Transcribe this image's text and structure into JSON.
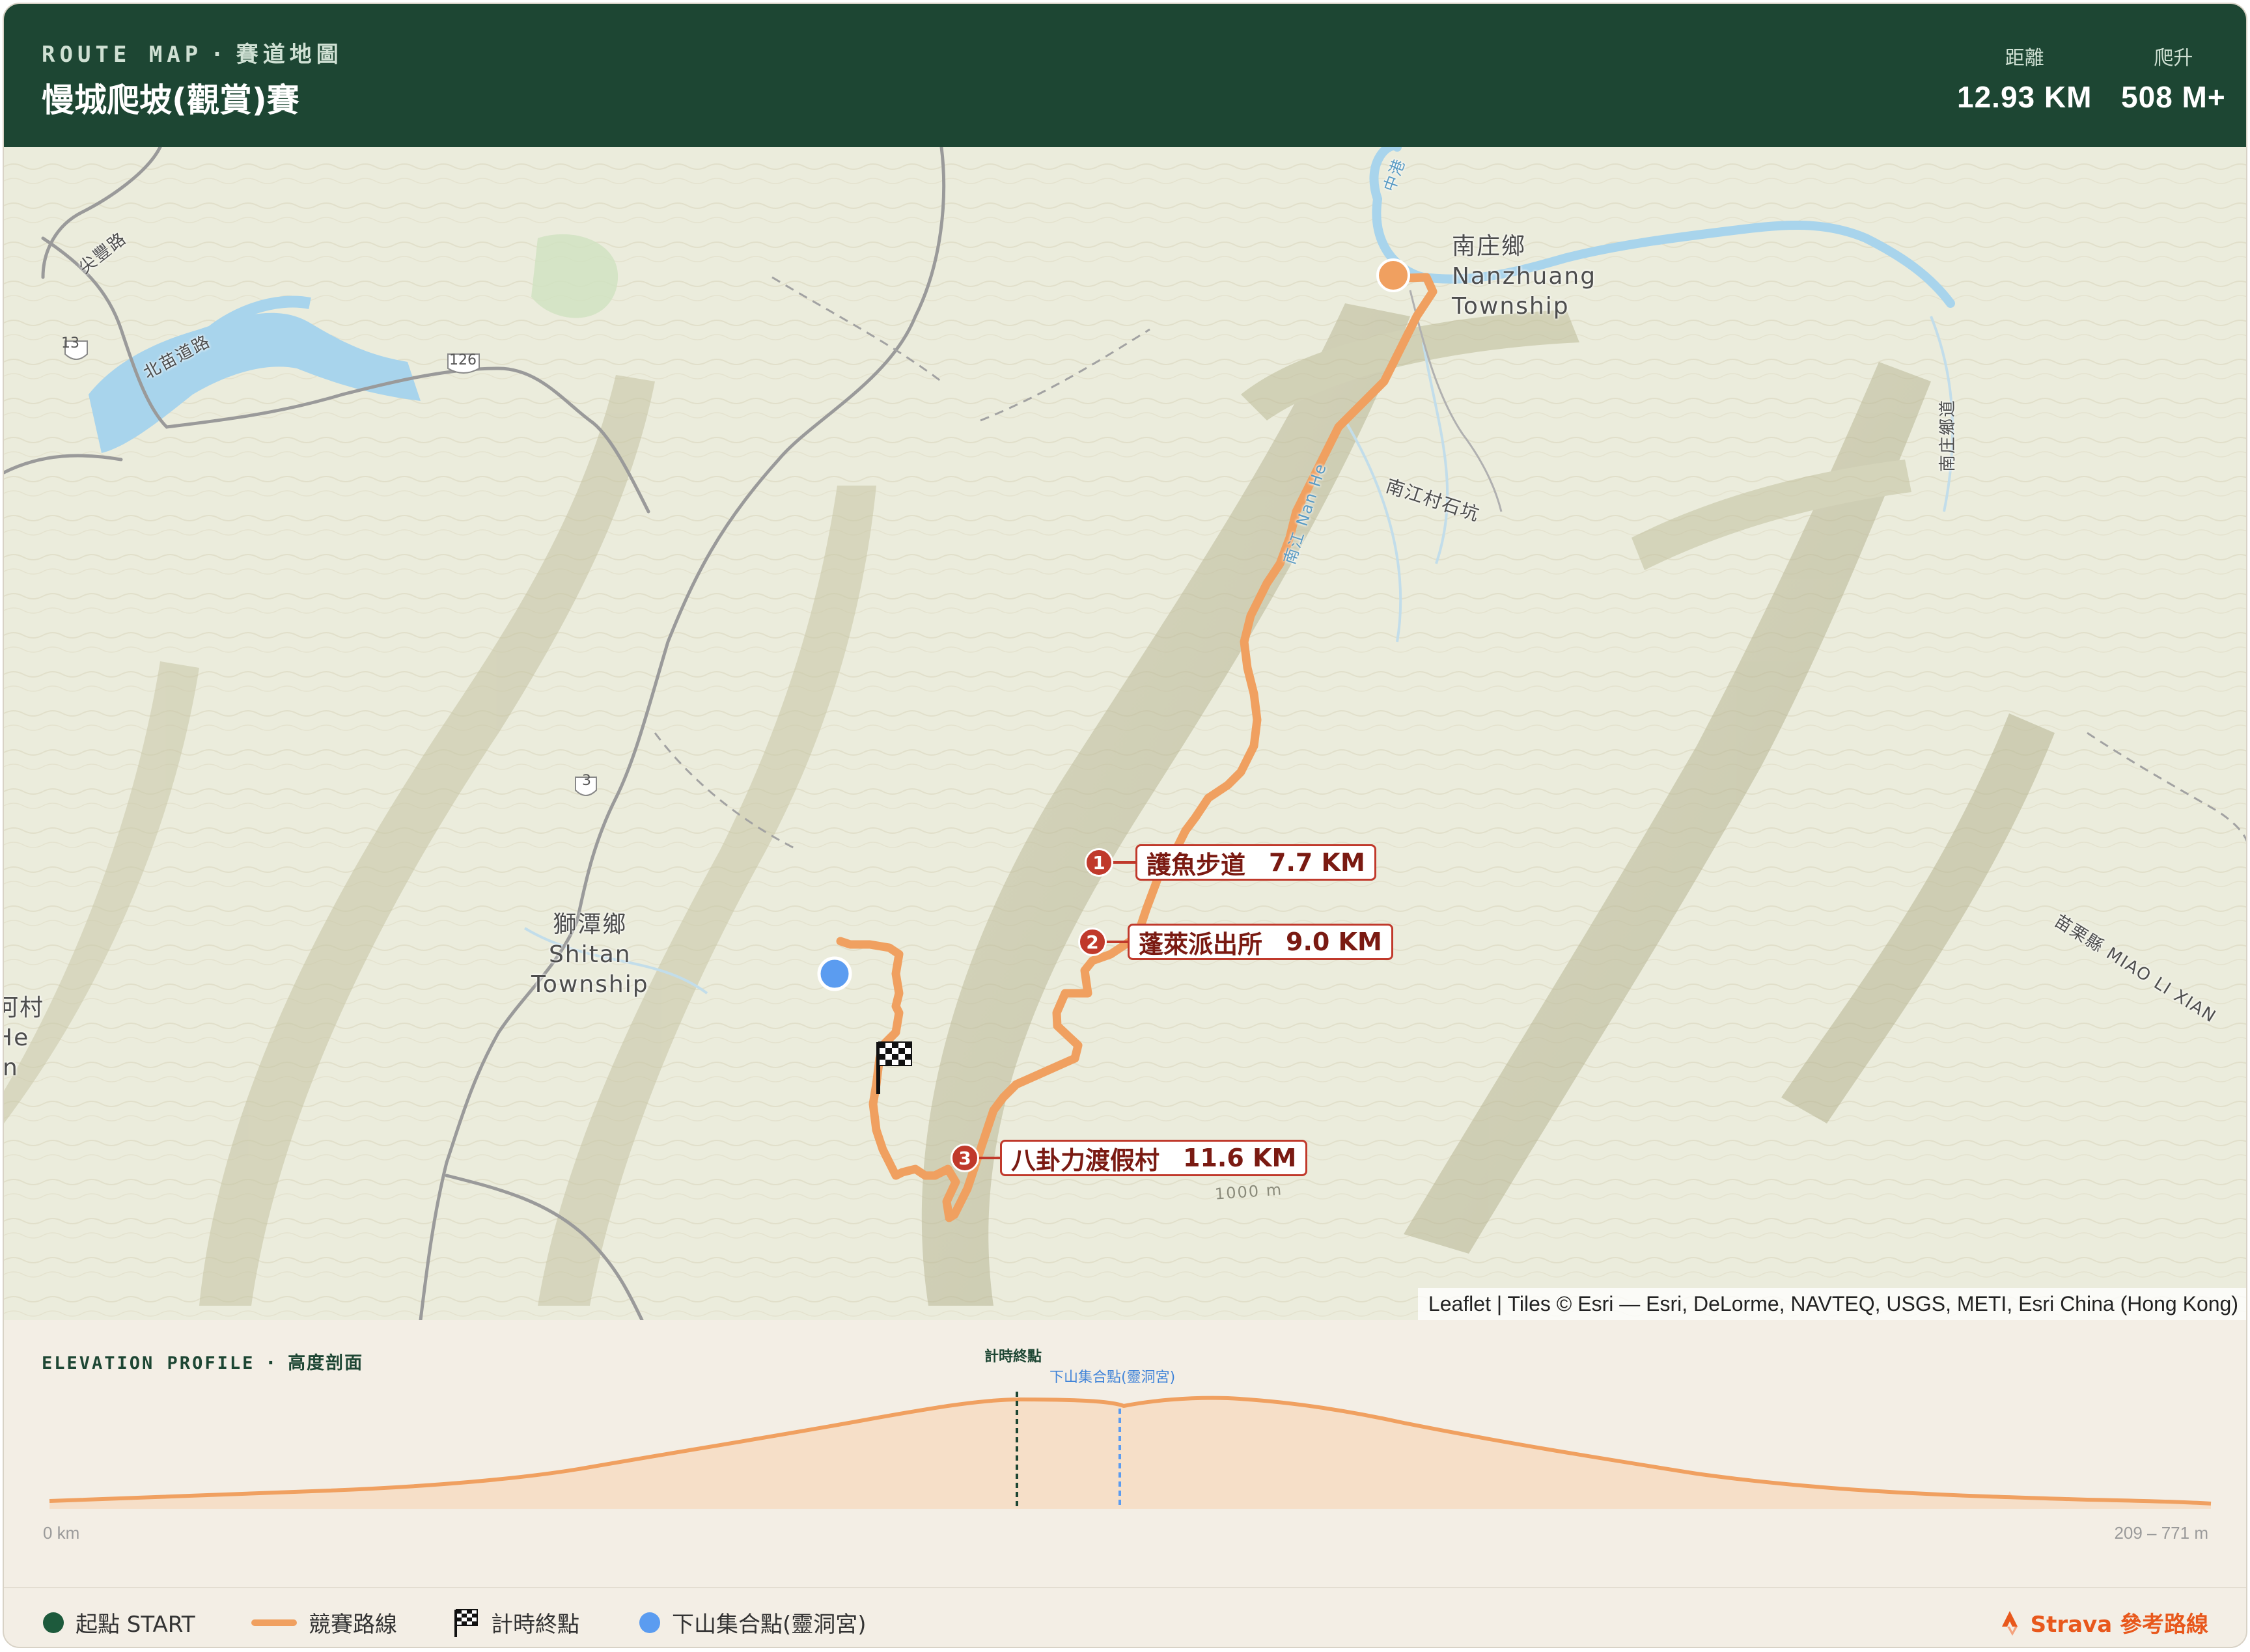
{
  "header": {
    "kicker_en": "ROUTE MAP",
    "kicker_sep": "·",
    "kicker_zh": "賽道地圖",
    "title": "慢城爬坡(觀賞)賽",
    "stats": [
      {
        "label": "距離",
        "value": "12.93 KM"
      },
      {
        "label": "爬升",
        "value": "508 M+"
      }
    ]
  },
  "map": {
    "place_labels": {
      "nanzhuang": [
        "南庄鄉",
        "Nanzhuang",
        "Township"
      ],
      "shitan": [
        "獅潭鄉",
        "Shitan",
        "Township"
      ],
      "left_edge": [
        "河村",
        "He",
        "in"
      ],
      "shikeng": "南江村石坑",
      "nan_he": "南江 Nan He",
      "zhonggang": "中港",
      "road_left_top": "尖豐路",
      "road_left_mid": "北苗道路",
      "right_road": "南庄鄉道",
      "county": "苗栗縣 MIAO LI XIAN",
      "contour": "1000 m"
    },
    "road_shields": [
      "13",
      "126",
      "3"
    ],
    "checkpoints": [
      {
        "num": "1",
        "name": "護魚步道",
        "dist": "7.7 KM"
      },
      {
        "num": "2",
        "name": "蓬萊派出所",
        "dist": "9.0 KM"
      },
      {
        "num": "3",
        "name": "八卦力渡假村",
        "dist": "11.6 KM"
      }
    ],
    "attribution": "Leaflet | Tiles © Esri — Esri, DeLorme, NAVTEQ, USGS, METI, Esri China (Hong Kong)"
  },
  "elevation": {
    "title_en": "ELEVATION PROFILE",
    "title_sep": "·",
    "title_zh": "高度剖面",
    "axis_start": "0 km",
    "axis_end": "209 – 771 m",
    "finish_label": "計時終點",
    "gather_label": "下山集合點(靈洞宮)"
  },
  "legend": {
    "items": [
      "起點 START",
      "競賽路線",
      "計時終點",
      "下山集合點(靈洞宮)"
    ],
    "strava": "Strava 參考路線"
  },
  "colors": {
    "header_bg": "#1d4633",
    "route": "#f0a060",
    "start": "#1d5a3c",
    "gather": "#5b9cf0",
    "checkpoint": "#c0392b",
    "strava": "#e8581c"
  }
}
